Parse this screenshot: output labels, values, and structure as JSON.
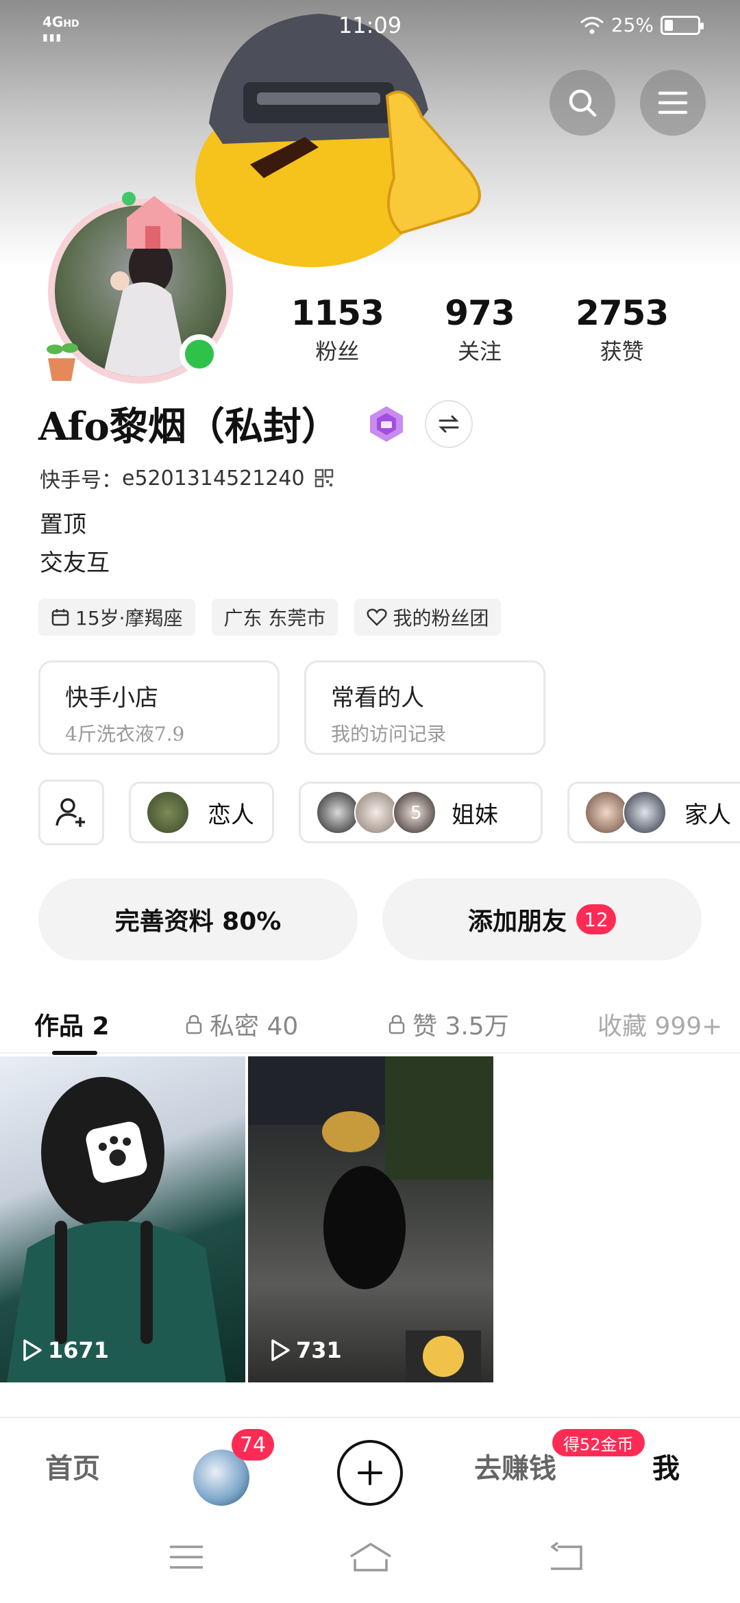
{
  "status_bar": {
    "network": "4G",
    "network_sub": "HD",
    "time": "11:09",
    "battery": "25%",
    "battery_level": 0.25
  },
  "header": {
    "search_icon": "search-icon",
    "menu_icon": "menu-icon"
  },
  "profile": {
    "stats": [
      {
        "value": "1153",
        "label": "粉丝"
      },
      {
        "value": "973",
        "label": "关注"
      },
      {
        "value": "2753",
        "label": "获赞"
      }
    ],
    "name": "Afo黎烟（私封）",
    "kuaishou_id_label": "快手号：",
    "kuaishou_id": "e5201314521240",
    "bio_lines": [
      "置顶",
      "交友互"
    ],
    "tags": [
      {
        "icon": "calendar-icon",
        "text": "15岁·摩羯座"
      },
      {
        "icon": "",
        "text": "广东 东莞市"
      },
      {
        "icon": "heart-icon",
        "text": "我的粉丝团"
      }
    ]
  },
  "cards": [
    {
      "title": "快手小店",
      "subtitle": "4斤洗衣液7.9"
    },
    {
      "title": "常看的人",
      "subtitle": "我的访问记录"
    }
  ],
  "groups": [
    {
      "label": "恋人",
      "count": ""
    },
    {
      "label": "姐妹",
      "count": "5"
    },
    {
      "label": "家人",
      "count": ""
    }
  ],
  "actions": {
    "complete_profile": "完善资料 80%",
    "add_friends": "添加朋友",
    "add_friends_badge": "12"
  },
  "tabs": [
    {
      "label": "作品 2",
      "locked": false,
      "active": true
    },
    {
      "label": "私密 40",
      "locked": true,
      "active": false
    },
    {
      "label": "赞 3.5万",
      "locked": true,
      "active": false
    },
    {
      "label": "收藏 999+",
      "locked": false,
      "active": false
    }
  ],
  "videos": [
    {
      "plays": "1671"
    },
    {
      "plays": "731"
    }
  ],
  "bottom_nav": {
    "home": "首页",
    "messages_badge": "74",
    "earn": "去赚钱",
    "earn_badge": "得52金币",
    "me": "我"
  }
}
